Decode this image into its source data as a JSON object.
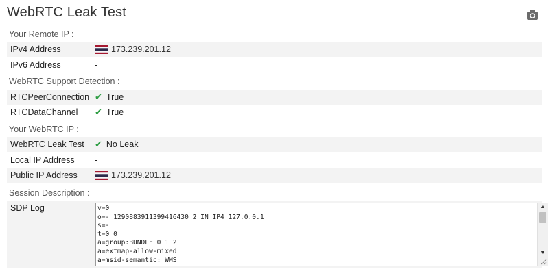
{
  "title": "WebRTC Leak Test",
  "icons": {
    "camera": "camera-icon",
    "flag": "thailand-flag-icon",
    "check": "checkmark-icon"
  },
  "colors": {
    "check": "#2f9e44",
    "row_bg": "#f3f3f3",
    "link": "#333333"
  },
  "remote_ip": {
    "heading": "Your Remote IP :",
    "ipv4_label": "IPv4 Address",
    "ipv4_value": "173.239.201.12",
    "ipv6_label": "IPv6 Address",
    "ipv6_value": "-"
  },
  "support": {
    "heading": "WebRTC Support Detection :",
    "peer_label": "RTCPeerConnection",
    "peer_value": "True",
    "data_label": "RTCDataChannel",
    "data_value": "True"
  },
  "webrtc_ip": {
    "heading": "Your WebRTC IP :",
    "leak_label": "WebRTC Leak Test",
    "leak_value": "No Leak",
    "local_label": "Local IP Address",
    "local_value": "-",
    "public_label": "Public IP Address",
    "public_value": "173.239.201.12"
  },
  "session": {
    "heading": "Session Description :",
    "sdp_label": "SDP Log",
    "sdp_text": "v=0\no=- 1290883911399416430 2 IN IP4 127.0.0.1\ns=-\nt=0 0\na=group:BUNDLE 0 1 2\na=extmap-allow-mixed\na=msid-semantic: WMS"
  }
}
